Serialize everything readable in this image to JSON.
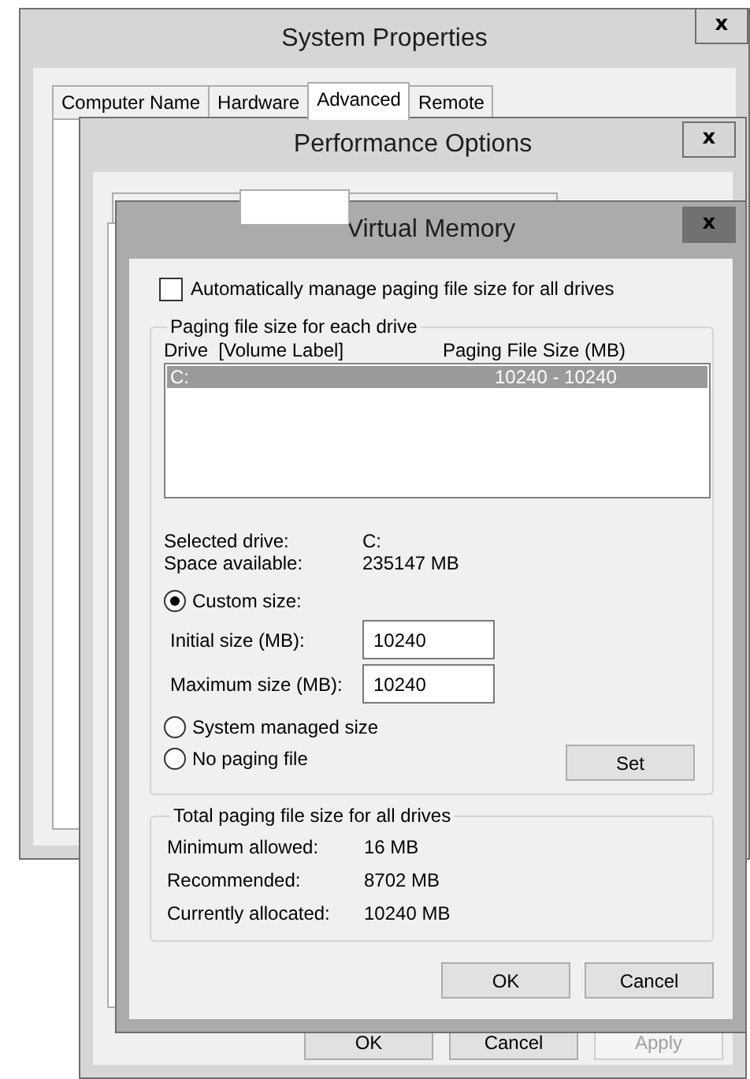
{
  "system_properties": {
    "title": "System Properties",
    "close": "x",
    "tabs": [
      {
        "label": "Computer Name",
        "selected": false
      },
      {
        "label": "Hardware",
        "selected": false
      },
      {
        "label": "Advanced",
        "selected": true
      },
      {
        "label": "Remote",
        "selected": false
      }
    ]
  },
  "performance_options": {
    "title": "Performance Options",
    "close": "x",
    "tabs": [
      {
        "selected": false
      },
      {
        "selected": true
      },
      {
        "selected": false
      }
    ],
    "buttons": [
      {
        "label": "OK",
        "disabled": false
      },
      {
        "label": "Cancel",
        "disabled": false
      },
      {
        "label": "Apply",
        "disabled": true
      }
    ]
  },
  "virtual_memory": {
    "title": "Virtual Memory",
    "close": "x",
    "auto_manage": {
      "label": "Automatically manage paging file size for all drives",
      "checked": false
    },
    "paging_group": {
      "title": "Paging file size for each drive",
      "columns": [
        "Drive  [Volume Label]",
        "Paging File Size (MB)"
      ],
      "drives": [
        {
          "drive": "C:",
          "size": "10240 - 10240",
          "selected": true
        }
      ],
      "details": [
        {
          "label": "Selected drive:",
          "value": "C:"
        },
        {
          "label": "Space available:",
          "value": "235147 MB"
        }
      ],
      "custom_size": {
        "label": "Custom size:",
        "selected": true
      },
      "fields": [
        {
          "label": "Initial size (MB):",
          "value": "10240"
        },
        {
          "label": "Maximum size (MB):",
          "value": "10240"
        }
      ],
      "system_managed": {
        "label": "System managed size",
        "selected": false
      },
      "no_paging": {
        "label": "No paging file",
        "selected": false
      },
      "set_button": "Set"
    },
    "total_group": {
      "title": "Total paging file size for all drives",
      "rows": [
        {
          "label": "Minimum allowed:",
          "value": "16 MB"
        },
        {
          "label": "Recommended:",
          "value": "8702 MB"
        },
        {
          "label": "Currently allocated:",
          "value": "10240 MB"
        }
      ]
    },
    "buttons": [
      {
        "label": "OK"
      },
      {
        "label": "Cancel"
      }
    ]
  }
}
